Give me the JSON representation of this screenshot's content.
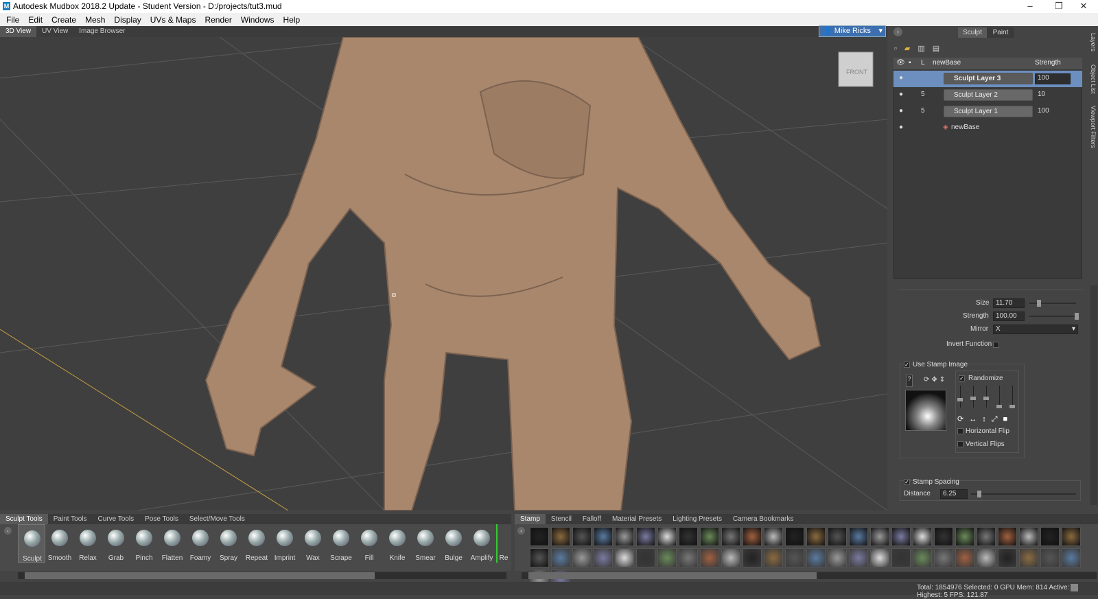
{
  "window": {
    "title": "Autodesk Mudbox 2018.2 Update - Student Version - D:/projects/tut3.mud",
    "logo": "M"
  },
  "menu": [
    "File",
    "Edit",
    "Create",
    "Mesh",
    "Display",
    "UVs & Maps",
    "Render",
    "Windows",
    "Help"
  ],
  "view_tabs": [
    "3D View",
    "UV View",
    "Image Browser"
  ],
  "user": "Mike Ricks",
  "viewcube_label": "FRONT",
  "mode_tabs": [
    "Sculpt",
    "Paint"
  ],
  "side_tabs": [
    "Layers",
    "Object List",
    "Viewport Filters"
  ],
  "layers": {
    "header": {
      "name": "newBase",
      "strength": "Strength",
      "lock": "L"
    },
    "rows": [
      {
        "name": "Sculpt Layer 3",
        "strength": "100",
        "count": ""
      },
      {
        "name": "Sculpt Layer 2",
        "strength": "10",
        "count": "5"
      },
      {
        "name": "Sculpt Layer 1",
        "strength": "100",
        "count": "5"
      },
      {
        "name": "newBase",
        "strength": "",
        "count": ""
      }
    ]
  },
  "properties": {
    "size_label": "Size",
    "size_value": "11.70",
    "strength_label": "Strength",
    "strength_value": "100.00",
    "mirror_label": "Mirror",
    "mirror_value": "X",
    "invert_label": "Invert Function",
    "use_stamp_label": "Use Stamp Image",
    "randomize_label": "Randomize",
    "hflip_label": "Horizontal Flip",
    "vflip_label": "Vertical Flips",
    "stamp_spacing_label": "Stamp Spacing",
    "distance_label": "Distance",
    "distance_value": "6.25"
  },
  "tool_tabs": [
    "Sculpt Tools",
    "Paint Tools",
    "Curve Tools",
    "Pose Tools",
    "Select/Move Tools"
  ],
  "tools": [
    "Sculpt",
    "Smooth",
    "Relax",
    "Grab",
    "Pinch",
    "Flatten",
    "Foamy",
    "Spray",
    "Repeat",
    "Imprint",
    "Wax",
    "Scrape",
    "Fill",
    "Knife",
    "Smear",
    "Bulge",
    "Amplify",
    "Re"
  ],
  "stamp_tabs": [
    "Stamp",
    "Stencil",
    "Falloff",
    "Material Presets",
    "Lighting Presets",
    "Camera Bookmarks"
  ],
  "status": "Total: 1854976  Selected: 0 GPU Mem: 814  Active: 5, Highest: 5  FPS: 121.87",
  "colors": {
    "selection": "#6c8fbf",
    "skin": "#a8876c",
    "axis_line": "#c8a040"
  }
}
